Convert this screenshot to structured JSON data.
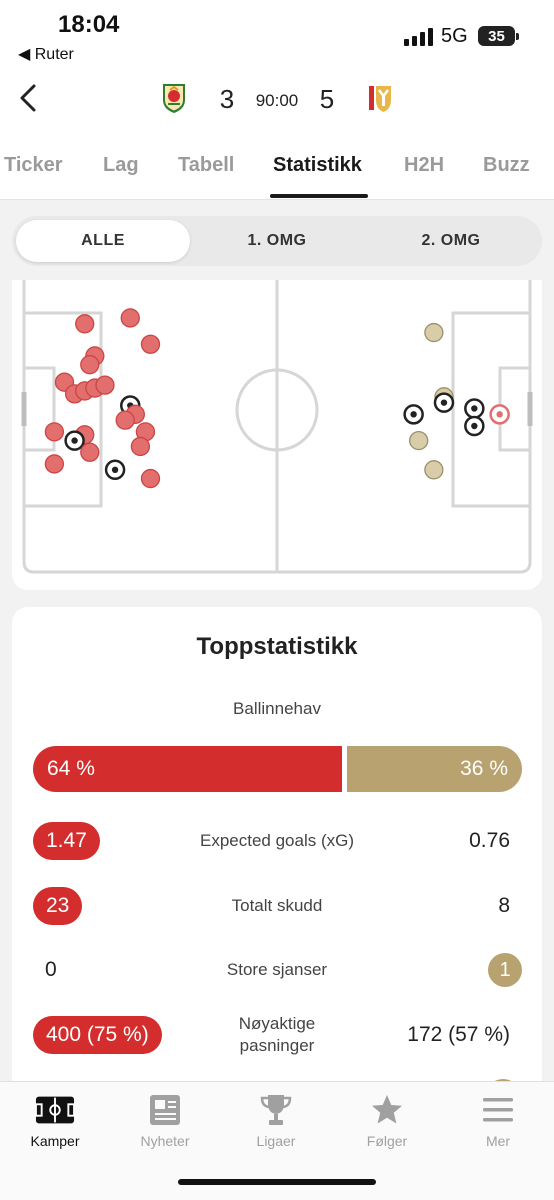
{
  "status_bar": {
    "time": "18:04",
    "back_app": "◀ Ruter",
    "network": "5G",
    "battery": "35"
  },
  "match": {
    "home_score": "3",
    "away_score": "5",
    "clock": "90:00",
    "home_crest_icon": "wrexham-crest-icon",
    "away_crest_icon": "mk-dons-crest-icon"
  },
  "tabs": [
    {
      "label": "Ticker",
      "active": false
    },
    {
      "label": "Lag",
      "active": false
    },
    {
      "label": "Tabell",
      "active": false
    },
    {
      "label": "Statistikk",
      "active": true
    },
    {
      "label": "H2H",
      "active": false
    },
    {
      "label": "Buzz",
      "active": false
    }
  ],
  "segments": [
    {
      "label": "ALLE",
      "active": true
    },
    {
      "label": "1. OMG",
      "active": false
    },
    {
      "label": "2. OMG",
      "active": false
    }
  ],
  "shot_map": {
    "home_color": "#e36e6e",
    "away_color": "#d8cda8",
    "pitch_line_color": "#d6d6d6",
    "legend": "shots plotted in pitch units (0–100 along the pitch from the left goal line, 0–100 across it from the top touchline)",
    "home_shots": [
      {
        "x": 12,
        "y": 15,
        "goal": false
      },
      {
        "x": 21,
        "y": 13,
        "goal": false
      },
      {
        "x": 25,
        "y": 22,
        "goal": false
      },
      {
        "x": 14,
        "y": 26,
        "goal": false
      },
      {
        "x": 13,
        "y": 29,
        "goal": false
      },
      {
        "x": 8,
        "y": 35,
        "goal": false
      },
      {
        "x": 10,
        "y": 39,
        "goal": false
      },
      {
        "x": 12,
        "y": 38,
        "goal": false
      },
      {
        "x": 14,
        "y": 37,
        "goal": false
      },
      {
        "x": 16,
        "y": 36,
        "goal": false
      },
      {
        "x": 21,
        "y": 43,
        "goal": true
      },
      {
        "x": 22,
        "y": 46,
        "goal": false
      },
      {
        "x": 20,
        "y": 48,
        "goal": false
      },
      {
        "x": 6,
        "y": 52,
        "goal": false
      },
      {
        "x": 12,
        "y": 53,
        "goal": false
      },
      {
        "x": 10,
        "y": 55,
        "goal": true
      },
      {
        "x": 24,
        "y": 52,
        "goal": false
      },
      {
        "x": 23,
        "y": 57,
        "goal": false
      },
      {
        "x": 13,
        "y": 59,
        "goal": false
      },
      {
        "x": 6,
        "y": 63,
        "goal": false
      },
      {
        "x": 18,
        "y": 65,
        "goal": true
      },
      {
        "x": 25,
        "y": 68,
        "goal": false
      }
    ],
    "away_shots": [
      {
        "x": 81,
        "y": 18,
        "goal": false
      },
      {
        "x": 83,
        "y": 40,
        "goal": false
      },
      {
        "x": 83,
        "y": 42,
        "goal": true
      },
      {
        "x": 77,
        "y": 46,
        "goal": true
      },
      {
        "x": 89,
        "y": 44,
        "goal": true
      },
      {
        "x": 89,
        "y": 50,
        "goal": true
      },
      {
        "x": 78,
        "y": 55,
        "goal": false
      },
      {
        "x": 81,
        "y": 65,
        "goal": false
      },
      {
        "x": 94,
        "y": 46,
        "goal": true,
        "own_goal": true
      }
    ]
  },
  "stats": {
    "title": "Toppstatistikk",
    "possession": {
      "label": "Ballinnehav",
      "home": "64 %",
      "away": "36 %",
      "home_fraction": 0.64
    },
    "rows": [
      {
        "label": "Expected goals (xG)",
        "home": "1.47",
        "away": "0.76",
        "leader": "home"
      },
      {
        "label": "Totalt skudd",
        "home": "23",
        "away": "8",
        "leader": "home"
      },
      {
        "label": "Store sjanser",
        "home": "0",
        "away": "1",
        "leader": "away"
      },
      {
        "label": "Nøyaktige pasninger",
        "home": "400 (75 %)",
        "away": "172 (57 %)",
        "leader": "home"
      }
    ]
  },
  "bottom_nav": [
    {
      "label": "Kamper",
      "icon": "pitch-icon",
      "active": true
    },
    {
      "label": "Nyheter",
      "icon": "newspaper-icon",
      "active": false
    },
    {
      "label": "Ligaer",
      "icon": "trophy-icon",
      "active": false
    },
    {
      "label": "Følger",
      "icon": "star-icon",
      "active": false
    },
    {
      "label": "Mer",
      "icon": "menu-icon",
      "active": false
    }
  ],
  "colors": {
    "home_accent": "#d42d2d",
    "away_accent": "#b8a270"
  }
}
